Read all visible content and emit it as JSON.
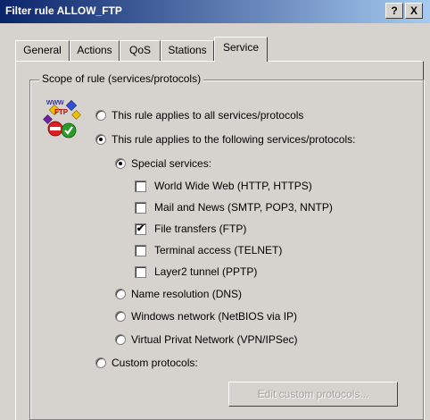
{
  "window": {
    "title": "Filter rule ALLOW_FTP",
    "help_label": "?",
    "close_label": "X"
  },
  "tabs": [
    {
      "label": "General"
    },
    {
      "label": "Actions"
    },
    {
      "label": "QoS"
    },
    {
      "label": "Stations"
    },
    {
      "label": "Service",
      "active": true
    }
  ],
  "group": {
    "legend": "Scope of rule (services/protocols)"
  },
  "scope": {
    "all_label": "This rule applies to all services/protocols",
    "following_label": "This rule applies to the following services/protocols:",
    "selected": "following"
  },
  "special": {
    "label": "Special services:",
    "selected": true,
    "items": [
      {
        "label": "World Wide Web (HTTP, HTTPS)",
        "checked": false
      },
      {
        "label": "Mail and News (SMTP, POP3, NNTP)",
        "checked": false
      },
      {
        "label": "File transfers (FTP)",
        "checked": true
      },
      {
        "label": "Terminal access (TELNET)",
        "checked": false
      },
      {
        "label": "Layer2 tunnel (PPTP)",
        "checked": false
      }
    ]
  },
  "other_options": [
    {
      "label": "Name resolution (DNS)"
    },
    {
      "label": "Windows network (NetBIOS via IP)"
    },
    {
      "label": "Virtual Privat Network (VPN/IPSec)"
    }
  ],
  "custom": {
    "label": "Custom protocols:",
    "button_label": "Edit custom protocols..."
  },
  "icon": {
    "text_www": "www",
    "text_ftp": "FTP"
  },
  "colors": {
    "title_start": "#0a246a",
    "title_end": "#a6caf0",
    "face": "#d6d3ce",
    "deny": "#e02020",
    "allow": "#2a9a2a"
  }
}
